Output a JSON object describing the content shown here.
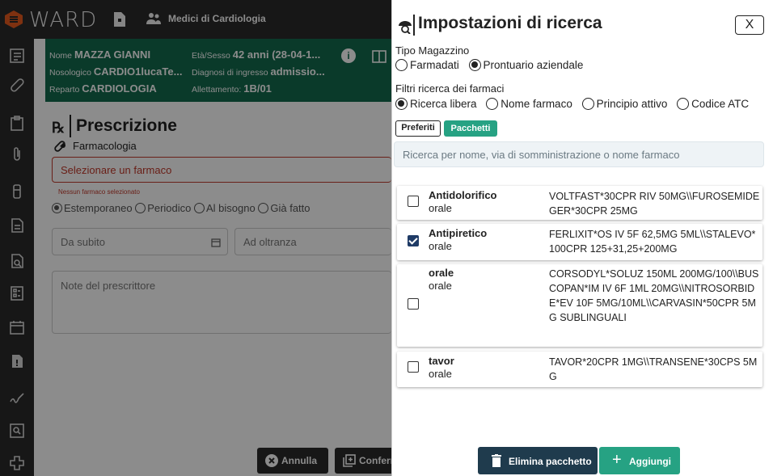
{
  "app": {
    "logo_text": "WARD",
    "group_label": "Medici di Cardiologia"
  },
  "patient": {
    "nome_label": "Nome",
    "nome_value": "MAZZA GIANNI",
    "eta_label": "Età/Sesso",
    "eta_value": "42 anni (28-04-1...",
    "nosologico_label": "Nosologico",
    "nosologico_value": "CARDIO1lucaTe...",
    "diagnosi_label": "Diagnosi di ingresso",
    "diagnosi_value": "admissio...",
    "reparto_label": "Reparto",
    "reparto_value": "CARDIOLOGIA",
    "allettamento_label": "Allettamento:",
    "allettamento_value": "1B/01"
  },
  "prescrizione": {
    "title": "Prescrizione",
    "rx_symbol": "℞",
    "section_label": "Farmacologia",
    "select_placeholder": "Selezionare un farmaco",
    "error_text": "Nessun farmaco selezionato",
    "frequency_options": [
      "Estemporaneo",
      "Periodico",
      "Al bisogno",
      "Già fatto"
    ],
    "frequency_selected": 0,
    "start_placeholder": "Da subito",
    "end_placeholder": "Ad oltranza",
    "notes_placeholder": "Note del prescrittore",
    "cancel_label": "Annulla",
    "confirm_label": "Conferma"
  },
  "drawer": {
    "title": "Impostazioni di ricerca",
    "close_label": "X",
    "tipo_magazzino_label": "Tipo Magazzino",
    "magazzino_options": [
      "Farmadati",
      "Prontuario aziendale"
    ],
    "magazzino_selected": 1,
    "filtri_label": "Filtri ricerca dei farmaci",
    "filtri_options": [
      "Ricerca libera",
      "Nome farmaco",
      "Principio attivo",
      "Codice ATC"
    ],
    "filtri_selected": 0,
    "preferiti_label": "Preferiti",
    "pacchetti_label": "Pacchetti",
    "search_placeholder": "Ricerca per nome, via di somministrazione o nome farmaco",
    "packages": [
      {
        "name": "Antidolorifico",
        "via": "orale",
        "checked": false,
        "drugs": "VOLTFAST*30CPR RIV 50MG\\\\FUROSEMIDE GER*30CPR 25MG"
      },
      {
        "name": "Antipiretico",
        "via": "orale",
        "checked": true,
        "drugs": "FERLIXIT*OS IV 5F 62,5MG 5ML\\\\STALEVO*100CPR 125+31,25+200MG"
      },
      {
        "name": "orale",
        "via": "orale",
        "checked": false,
        "drugs": "CORSODYL*SOLUZ 150ML 200MG/100\\\\BUSCOPAN*IM IV 6F 1ML 20MG\\\\NITROSORBIDE*EV 10F 5MG/10ML\\\\CARVASIN*50CPR 5MG SUBLINGUALI"
      },
      {
        "name": "tavor",
        "via": "orale",
        "checked": false,
        "drugs": "TAVOR*20CPR 1MG\\\\TRANSENE*30CPS 5MG"
      }
    ],
    "delete_label": "Elimina pacchetto",
    "add_label": "Aggiungi"
  },
  "colors": {
    "accent_green": "#26a283",
    "header_green": "#136b4e",
    "dark": "#2b2b2b",
    "error": "#c0392b",
    "checkbox_blue": "#1f3b66"
  }
}
